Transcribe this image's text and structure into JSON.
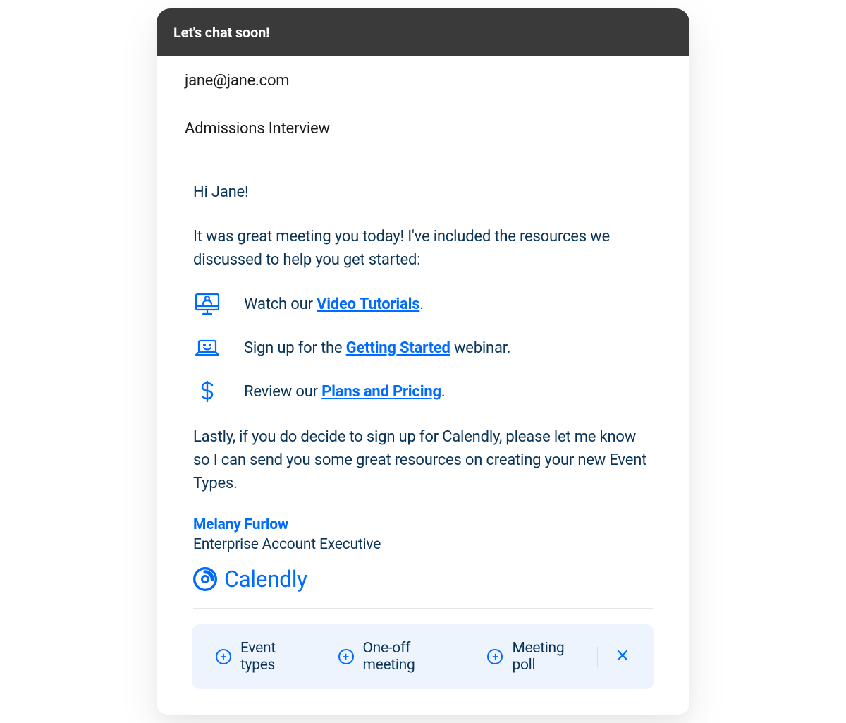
{
  "header": {
    "title": "Let's chat soon!"
  },
  "meta": {
    "to": "jane@jane.com",
    "subject": "Admissions Interview"
  },
  "body": {
    "greeting": "Hi Jane!",
    "intro": "It was great meeting you today! I've included the resources we discussed to help you get started:",
    "resources": [
      {
        "prefix": "Watch our ",
        "link": "Video Tutorials",
        "suffix": ".",
        "icon": "monitor-person-icon"
      },
      {
        "prefix": "Sign up for the ",
        "link": "Getting Started",
        "suffix": " webinar.",
        "icon": "laptop-smile-icon"
      },
      {
        "prefix": "Review our ",
        "link": "Plans and Pricing",
        "suffix": ".",
        "icon": "dollar-icon"
      }
    ],
    "closing": "Lastly, if you do decide to sign up for Calendly, please let me know so I can send you some great resources on creating your new Event Types."
  },
  "signature": {
    "name": "Melany Furlow",
    "title": "Enterprise Account Executive",
    "brand": "Calendly"
  },
  "action_bar": {
    "items": [
      {
        "label": "Event types"
      },
      {
        "label": "One-off meeting"
      },
      {
        "label": "Meeting poll"
      }
    ]
  },
  "colors": {
    "accent": "#006bff",
    "text_dark": "#0b3558",
    "header_bg": "#3a3a3a",
    "bar_bg": "#eef4fd"
  }
}
